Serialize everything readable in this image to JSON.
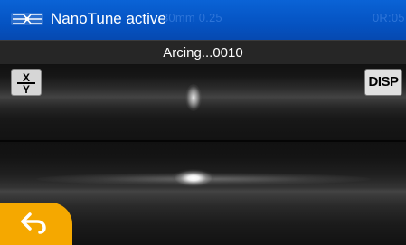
{
  "header": {
    "status": "NanoTune active",
    "ghost_center": "30mm 0.25",
    "ghost_right": "",
    "ghost_far": "0R:05",
    "mode_icon": "fiber-splice-icon",
    "color": "#0553c2"
  },
  "subheader": {
    "title": "Arcing...0010"
  },
  "controls": {
    "xy_top": "X",
    "xy_bottom": "Y",
    "disp_label": "DISP",
    "back_icon": "back-arrow-icon",
    "back_color": "#f5a800"
  }
}
